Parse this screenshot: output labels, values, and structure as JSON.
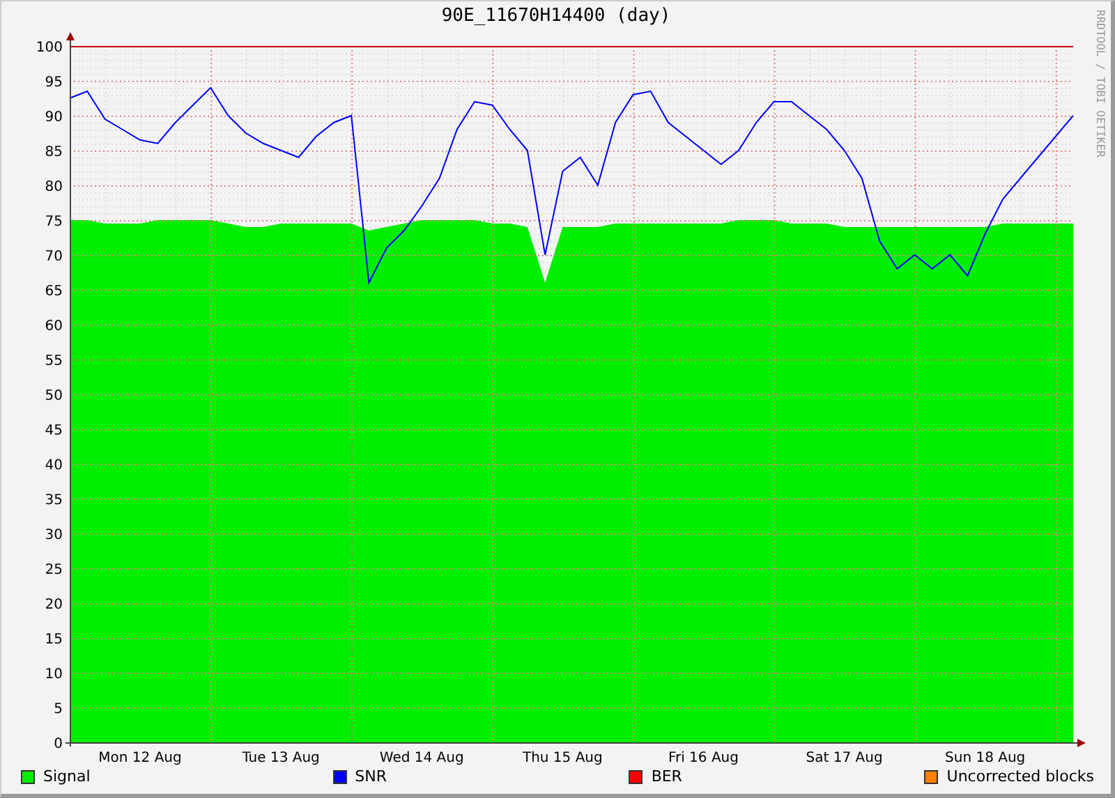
{
  "title": "90E_11670H14400 (day)",
  "side_text": "RRDTOOL / TOBI OETIKER",
  "chart_data": {
    "type": "area",
    "grid": true,
    "ylim": [
      0,
      100
    ],
    "categories": [
      null,
      null,
      null,
      null,
      "Mon 12 Aug",
      null,
      null,
      null,
      null,
      null,
      null,
      null,
      "Tue 13 Aug",
      null,
      null,
      null,
      null,
      null,
      null,
      null,
      "Wed 14 Aug",
      null,
      null,
      null,
      null,
      null,
      null,
      null,
      "Thu 15 Aug",
      null,
      null,
      null,
      null,
      null,
      null,
      null,
      "Fri 16 Aug",
      null,
      null,
      null,
      null,
      null,
      null,
      null,
      "Sat 17 Aug",
      null,
      null,
      null,
      null,
      null,
      null,
      null,
      "Sun 18 Aug",
      null,
      null,
      null,
      null,
      null
    ],
    "yticks": [
      0,
      5,
      10,
      15,
      20,
      25,
      30,
      35,
      40,
      45,
      50,
      55,
      60,
      65,
      70,
      75,
      80,
      85,
      90,
      95,
      100
    ],
    "series": [
      {
        "name": "Signal",
        "type": "area",
        "color": "#00ee00",
        "values": [
          75,
          75,
          74.5,
          74.5,
          74.5,
          75,
          75,
          75,
          75,
          74.5,
          74,
          74,
          74.5,
          74.5,
          74.5,
          74.5,
          74.5,
          73.5,
          74,
          74.5,
          75,
          75,
          75,
          75,
          74.5,
          74.5,
          74,
          66,
          74,
          74,
          74,
          74.5,
          74.5,
          74.5,
          74.5,
          74.5,
          74.5,
          74.5,
          75,
          75,
          75,
          74.5,
          74.5,
          74.5,
          74,
          74,
          74,
          74,
          74,
          74,
          74,
          74,
          74,
          74.5,
          74.5,
          74.5,
          74.5,
          74.5
        ]
      },
      {
        "name": "SNR",
        "type": "line",
        "color": "#0000ff",
        "values": [
          92.5,
          93.5,
          89.5,
          88,
          86.5,
          86,
          89,
          91.5,
          94,
          90,
          87.5,
          86,
          85,
          84,
          87,
          89,
          90,
          66,
          71,
          73.5,
          77,
          81,
          88,
          92,
          91.5,
          88,
          85,
          70,
          82,
          84,
          80,
          89,
          93,
          93.5,
          89,
          87,
          85,
          83,
          85,
          89,
          92,
          92,
          90,
          88,
          85,
          81,
          72,
          68,
          70,
          68,
          70,
          67,
          73,
          78,
          81,
          84,
          87,
          90
        ]
      },
      {
        "name": "BER",
        "type": "line",
        "color": "#ff0000",
        "values": [
          null,
          null,
          null,
          null,
          null,
          null,
          null,
          null,
          null,
          null,
          null,
          null,
          null,
          null,
          null,
          null,
          null,
          null,
          null,
          null,
          null,
          null,
          null,
          null,
          null,
          null,
          null,
          null,
          null,
          null,
          null,
          null,
          null,
          null,
          null,
          null,
          null,
          null,
          null,
          null,
          null,
          null,
          null,
          null,
          null,
          null,
          null,
          null,
          null,
          null,
          null,
          null,
          null,
          null,
          null,
          null,
          null,
          null
        ]
      },
      {
        "name": "Uncorrected blocks",
        "type": "line",
        "color": "#ff8000",
        "values": [
          null,
          null,
          null,
          null,
          null,
          null,
          null,
          null,
          null,
          null,
          null,
          null,
          null,
          null,
          null,
          null,
          null,
          null,
          null,
          null,
          null,
          null,
          null,
          null,
          null,
          null,
          null,
          null,
          null,
          null,
          null,
          null,
          null,
          null,
          null,
          null,
          null,
          null,
          null,
          null,
          null,
          null,
          null,
          null,
          null,
          null,
          null,
          null,
          null,
          null,
          null,
          null,
          null,
          null,
          null,
          null,
          null,
          null
        ]
      }
    ]
  }
}
